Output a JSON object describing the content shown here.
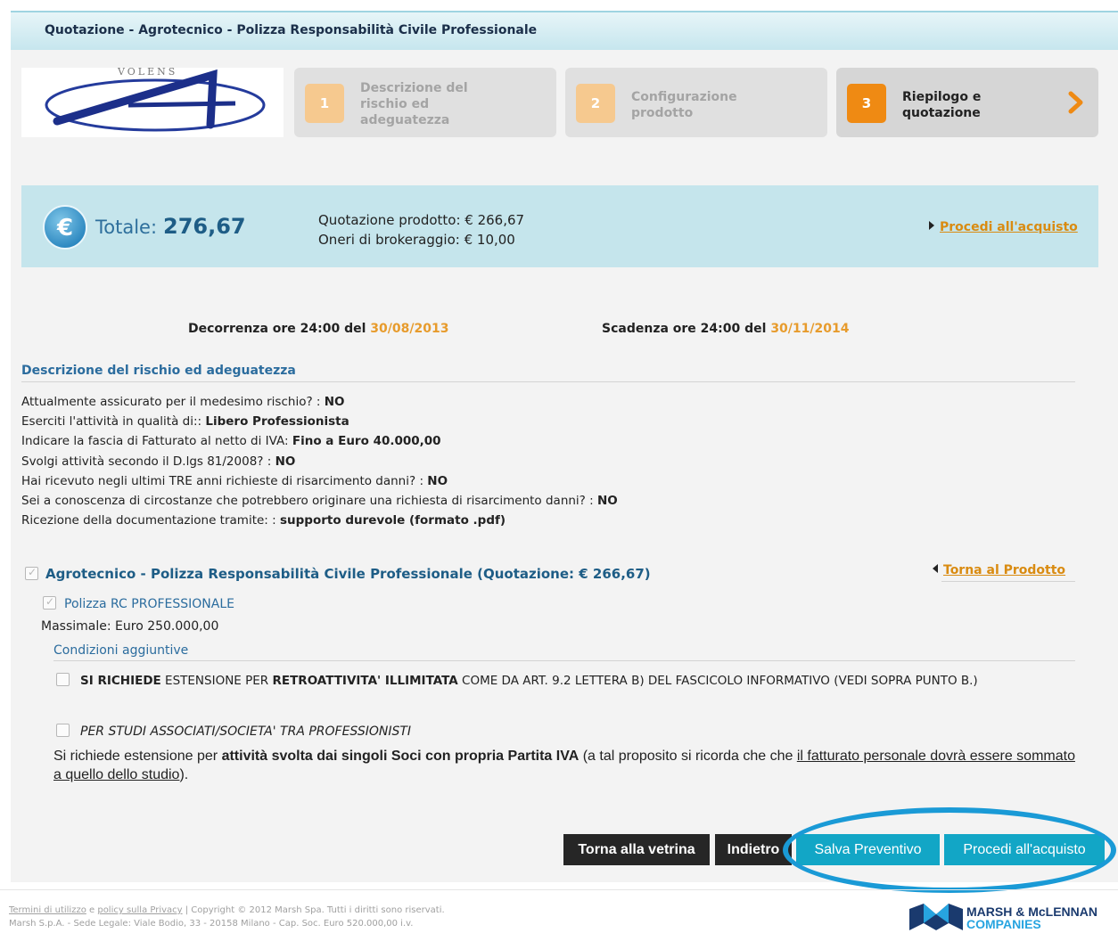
{
  "header": {
    "title": "Quotazione - Agrotecnico - Polizza Responsabilità Civile Professionale"
  },
  "logo": {
    "text": "VOLENS"
  },
  "steps": [
    {
      "number": "1",
      "label": "Descrizione del rischio ed adeguatezza",
      "active": false
    },
    {
      "number": "2",
      "label": "Configurazione prodotto",
      "active": false
    },
    {
      "number": "3",
      "label": "Riepilogo e quotazione",
      "active": true
    }
  ],
  "totals": {
    "label": "Totale:",
    "value": "276,67",
    "product_quote": "Quotazione prodotto: € 266,67",
    "brokerage": "Oneri di brokeraggio: € 10,00",
    "buy_link": "Procedi all'acquisto"
  },
  "dates": {
    "start_label": "Decorrenza ore 24:00 del",
    "start_value": "30/08/2013",
    "end_label": "Scadenza ore 24:00 del",
    "end_value": "30/11/2014"
  },
  "risk_section": {
    "title": "Descrizione del rischio ed adeguatezza",
    "items": [
      {
        "question": "Attualmente assicurato per il medesimo rischio? : ",
        "answer": "NO"
      },
      {
        "question": "Eserciti l'attività in qualità di:: ",
        "answer": "Libero Professionista"
      },
      {
        "question": "Indicare la fascia di Fatturato al netto di IVA: ",
        "answer": "Fino a Euro 40.000,00"
      },
      {
        "question": "Svolgi attività secondo il D.lgs 81/2008? : ",
        "answer": "NO"
      },
      {
        "question": "Hai ricevuto negli ultimi TRE anni richieste di risarcimento danni? : ",
        "answer": "NO"
      },
      {
        "question": "Sei a conoscenza di circostanze che potrebbero originare una richiesta di risarcimento danni? : ",
        "answer": "NO"
      },
      {
        "question": "Ricezione della documentazione tramite: : ",
        "answer": "supporto durevole (formato .pdf)"
      }
    ]
  },
  "product": {
    "title": "Agrotecnico - Polizza Responsabilità Civile Professionale (Quotazione: € 266,67)",
    "back_link": "Torna al Prodotto",
    "policy": "Polizza RC PROFESSIONALE",
    "massimale": "Massimale: Euro 250.000,00",
    "conditions_title": "Condizioni aggiuntive",
    "option1": {
      "part1": "SI RICHIEDE",
      "part2": " ESTENSIONE PER ",
      "part3": "RETROATTIVITA' ILLIMITATA",
      "part4": " COME DA ART. 9.2 LETTERA B) DEL FASCICOLO INFORMATIVO (VEDI SOPRA PUNTO B.)"
    },
    "option2": {
      "title": "PER STUDI ASSOCIATI/SOCIETA' TRA PROFESSIONISTI",
      "d1": "Si richiede estensione per ",
      "d2": "attività svolta dai singoli Soci con propria Partita IVA",
      "d3": " (a tal proposito si ricorda che che ",
      "d4": "il fatturato personale dovrà essere sommato a quello dello studio",
      "d5": ")."
    }
  },
  "buttons": {
    "back_to_showcase": "Torna alla vetrina",
    "back": "Indietro",
    "save_quote": "Salva Preventivo",
    "proceed": "Procedi all'acquisto"
  },
  "footer": {
    "terms": "Termini di utilizzo",
    "and": " e ",
    "privacy": "policy sulla Privacy",
    "copyright": " | Copyright © 2012 Marsh Spa. Tutti i diritti sono riservati.",
    "legal": "Marsh S.p.A. - Sede Legale: Viale Bodio, 33 - 20158 Milano - Cap. Soc. Euro 520.000,00 i.v.",
    "brand_line1": "MARSH & McLENNAN",
    "brand_line2": "COMPANIES"
  },
  "colors": {
    "accent_orange": "#ef8a13",
    "link_orange": "#d98b11",
    "title_blue": "#1e5d86",
    "button_blue": "#12a6c6",
    "button_dark": "#262626",
    "highlight": "#1a9ad6"
  }
}
